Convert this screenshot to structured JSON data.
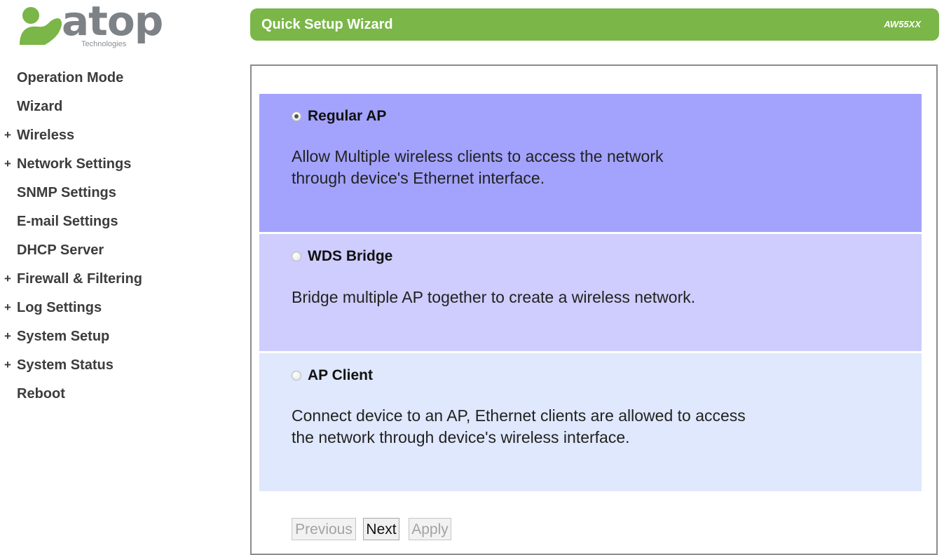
{
  "brand": {
    "name": "atop",
    "subtitle": "Technologies",
    "colors": {
      "green": "#7ab648",
      "gray": "#7d8287"
    }
  },
  "sidebar": {
    "items": [
      {
        "label": "Operation Mode",
        "expandable": false
      },
      {
        "label": "Wizard",
        "expandable": false
      },
      {
        "label": "Wireless",
        "expandable": true
      },
      {
        "label": "Network Settings",
        "expandable": true
      },
      {
        "label": "SNMP Settings",
        "expandable": false
      },
      {
        "label": "E-mail Settings",
        "expandable": false
      },
      {
        "label": "DHCP Server",
        "expandable": false
      },
      {
        "label": "Firewall & Filtering",
        "expandable": true
      },
      {
        "label": "Log Settings",
        "expandable": true
      },
      {
        "label": "System Setup",
        "expandable": true
      },
      {
        "label": "System Status",
        "expandable": true
      },
      {
        "label": "Reboot",
        "expandable": false
      }
    ],
    "expand_symbol": "+"
  },
  "header": {
    "title": "Quick Setup Wizard",
    "model": "AW55XX",
    "color": "#7ab648"
  },
  "wizard": {
    "selected": "Regular AP",
    "options": [
      {
        "title": "Regular AP",
        "checked": true,
        "desc_lines": [
          "Allow Multiple wireless clients to access the network",
          "through device's Ethernet interface."
        ],
        "color": "#a3a3fe"
      },
      {
        "title": "WDS Bridge",
        "checked": false,
        "desc_lines": [
          "Bridge multiple AP together to create a wireless network."
        ],
        "color": "#cecdfd"
      },
      {
        "title": "AP Client",
        "checked": false,
        "desc_lines": [
          "Connect device to an AP, Ethernet clients are allowed to access",
          "the network through device's wireless interface."
        ],
        "color": "#dfe8fc"
      }
    ],
    "buttons": {
      "previous": {
        "label": "Previous",
        "enabled": false
      },
      "next": {
        "label": "Next",
        "enabled": true
      },
      "apply": {
        "label": "Apply",
        "enabled": false
      }
    }
  }
}
